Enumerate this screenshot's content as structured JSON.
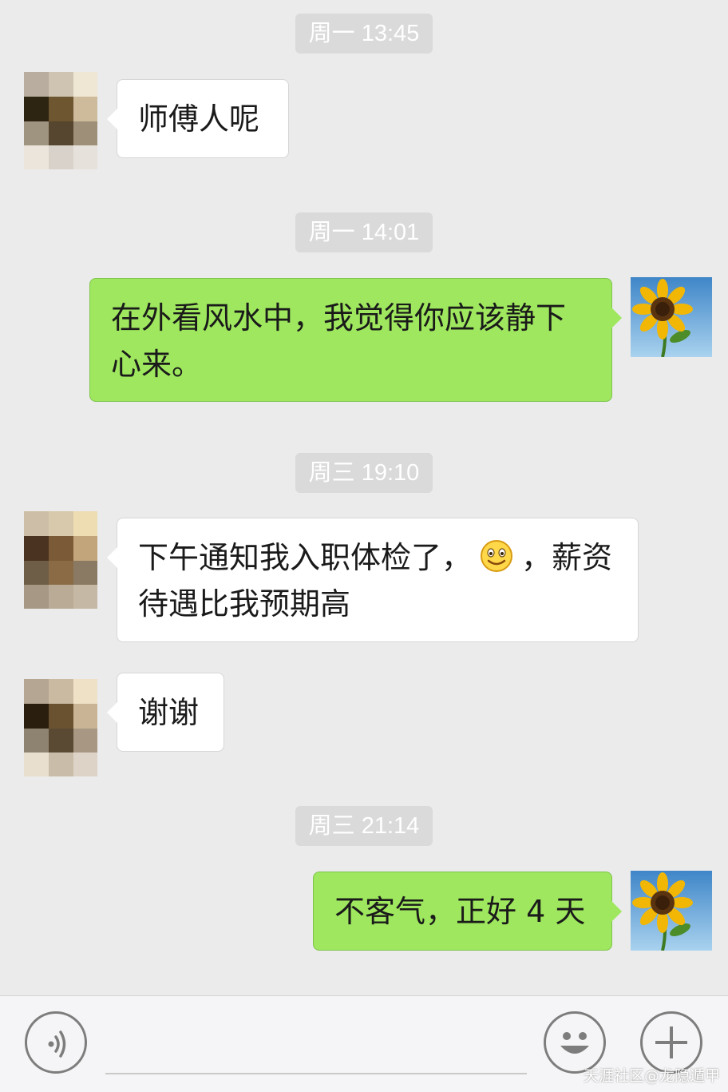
{
  "chat": {
    "messages": [
      {
        "type": "timestamp",
        "text": "周一 13:45"
      },
      {
        "type": "incoming",
        "lines": [
          "师傅人呢"
        ]
      },
      {
        "type": "timestamp",
        "text": "周一 14:01"
      },
      {
        "type": "outgoing",
        "lines": [
          "在外看风水中，我觉得你应该静下",
          "心来。"
        ]
      },
      {
        "type": "timestamp",
        "text": "周三 19:10"
      },
      {
        "type": "incoming",
        "line1_before_emoji": "下午通知我入职体检了，",
        "emoji": "smile-emoji",
        "line1_after_emoji": "，薪资",
        "line2": "待遇比我预期高"
      },
      {
        "type": "incoming",
        "lines": [
          "谢谢"
        ]
      },
      {
        "type": "timestamp",
        "text": "周三 21:14"
      },
      {
        "type": "outgoing",
        "lines": [
          "不客气，正好 4 天"
        ]
      }
    ]
  },
  "avatars": {
    "contact": "pixelated-avatar",
    "self": "sunflower-avatar"
  },
  "input_bar": {
    "voice_icon": "voice-icon",
    "emoji_icon": "emoji-icon",
    "plus_icon": "plus-icon"
  },
  "watermark": "天涯社区@龙隐遁甲",
  "colors": {
    "background": "#ebebeb",
    "incoming_bubble": "#ffffff",
    "outgoing_bubble": "#9ee75e",
    "timestamp_bg": "#dadada"
  }
}
